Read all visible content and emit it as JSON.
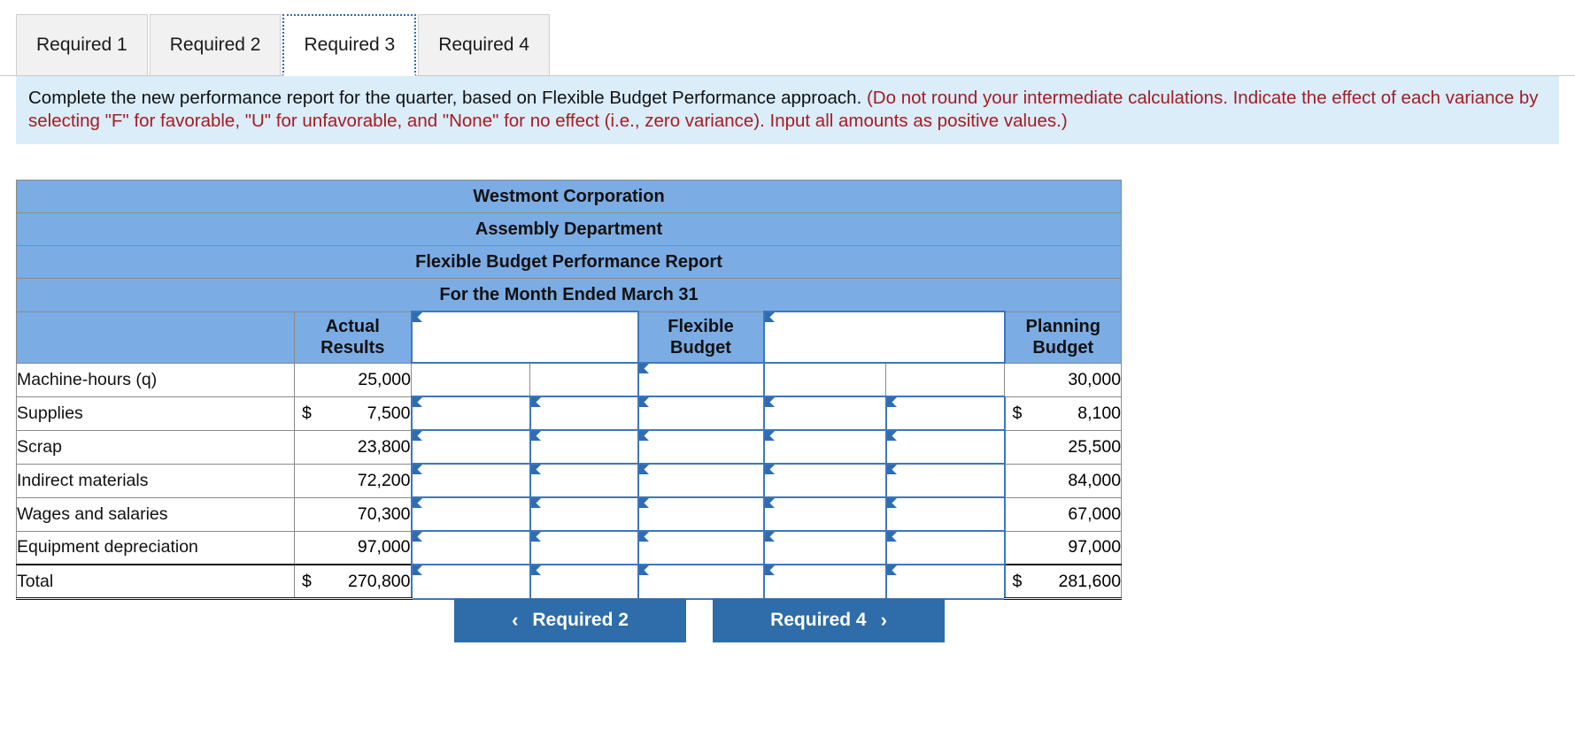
{
  "tabs": [
    {
      "label": "Required 1",
      "active": false
    },
    {
      "label": "Required 2",
      "active": false
    },
    {
      "label": "Required 3",
      "active": true
    },
    {
      "label": "Required 4",
      "active": false
    }
  ],
  "instructions": {
    "black_1": "Complete the new performance report for the quarter, based on Flexible Budget Performance approach. ",
    "red_1": "(Do not round your intermediate calculations. Indicate the effect of each variance by selecting \"F\" for favorable, \"U\" for unfavorable, and \"None\" for no effect (i.e., zero variance). Input all amounts as positive values.)"
  },
  "report": {
    "title_lines": [
      "Westmont Corporation",
      "Assembly Department",
      "Flexible Budget Performance Report",
      "For the Month Ended March 31"
    ],
    "column_headers": [
      {
        "label": "",
        "type": "label"
      },
      {
        "label": "Actual Results",
        "line1": "Actual",
        "line2": "Results",
        "type": "static"
      },
      {
        "label": "",
        "type": "input"
      },
      {
        "label": "Flexible Budget",
        "line1": "Flexible",
        "line2": "Budget",
        "type": "static"
      },
      {
        "label": "",
        "type": "input"
      },
      {
        "label": "Planning Budget",
        "line1": "Planning",
        "line2": "Budget",
        "type": "static"
      }
    ],
    "rows": [
      {
        "label": "Machine-hours (q)",
        "actual_dollar": "",
        "actual": "25,000",
        "planning_dollar": "",
        "planning": "30,000",
        "inputs": [
          "plain",
          "plain",
          "active",
          "plain",
          "plain"
        ],
        "total": false
      },
      {
        "label": "Supplies",
        "actual_dollar": "$",
        "actual": "7,500",
        "planning_dollar": "$",
        "planning": "8,100",
        "inputs": [
          "active",
          "active",
          "active",
          "active",
          "active"
        ],
        "total": false
      },
      {
        "label": "Scrap",
        "actual_dollar": "",
        "actual": "23,800",
        "planning_dollar": "",
        "planning": "25,500",
        "inputs": [
          "active",
          "active",
          "active",
          "active",
          "active"
        ],
        "total": false
      },
      {
        "label": "Indirect materials",
        "actual_dollar": "",
        "actual": "72,200",
        "planning_dollar": "",
        "planning": "84,000",
        "inputs": [
          "active",
          "active",
          "active",
          "active",
          "active"
        ],
        "total": false
      },
      {
        "label": "Wages and salaries",
        "actual_dollar": "",
        "actual": "70,300",
        "planning_dollar": "",
        "planning": "67,000",
        "inputs": [
          "active",
          "active",
          "active",
          "active",
          "active"
        ],
        "total": false
      },
      {
        "label": "Equipment depreciation",
        "actual_dollar": "",
        "actual": "97,000",
        "planning_dollar": "",
        "planning": "97,000",
        "inputs": [
          "active",
          "active",
          "active",
          "active",
          "active"
        ],
        "total": false
      },
      {
        "label": "Total",
        "actual_dollar": "$",
        "actual": "270,800",
        "planning_dollar": "$",
        "planning": "281,600",
        "inputs": [
          "active",
          "active",
          "active",
          "active",
          "active"
        ],
        "total": true
      }
    ]
  },
  "nav": {
    "prev_label": "Required 2",
    "prev_icon": "chevron-left-icon",
    "next_label": "Required 4",
    "next_icon": "chevron-right-icon"
  },
  "colors": {
    "header_blue": "#7bace4",
    "instruction_bg": "#daedf9",
    "instruction_red": "#a51c23",
    "button_blue": "#2e6daa",
    "input_border": "#3d77bc"
  }
}
